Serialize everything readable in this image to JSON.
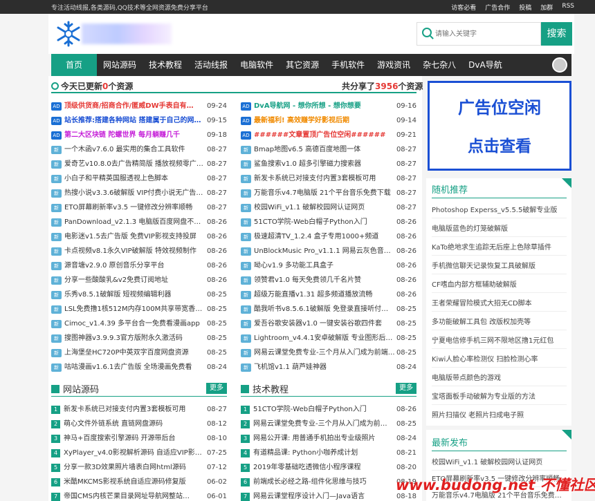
{
  "topbar": {
    "slogan": "专注活动线报,各类源码,QQ技术等全网资源免费分享平台",
    "links": [
      "访客必看",
      "广告合作",
      "投稿",
      "加群",
      "RSS"
    ]
  },
  "search": {
    "placeholder": "请输入关键字",
    "button": "搜索"
  },
  "nav": [
    "首页",
    "网站源码",
    "技术教程",
    "活动线报",
    "电脑软件",
    "其它资源",
    "手机软件",
    "游戏资讯",
    "杂七杂八",
    "DvA导航"
  ],
  "stats": {
    "today_prefix": "今天已更新",
    "today_count": "0",
    "today_suffix": "个资源",
    "total_prefix": "共分享了",
    "total_count": "3956",
    "total_suffix": "个资源"
  },
  "colors": {
    "accent": "#16a085",
    "dark": "#2d2d2d",
    "ad_blue": "#1a4fd4",
    "new_tag": "#5eb1d7",
    "red": "#e53935"
  },
  "left_list": [
    {
      "tag": "AD",
      "text": "顶级供货商/招商合作/匿威DW手表自有…",
      "date": "09-24",
      "style": "red"
    },
    {
      "tag": "AD",
      "text": "站长推荐:搭建各种网站 搭建属于自己的网…",
      "date": "09-15",
      "style": "blue"
    },
    {
      "tag": "AD",
      "text": "第二大区块链 陀螺世界 每月躺赚几千",
      "date": "09-18",
      "style": "purple"
    },
    {
      "tag": "新",
      "text": "一个木函v7.6.0 最实用的集合工具软件",
      "date": "08-27"
    },
    {
      "tag": "新",
      "text": "爱奇艺v10.8.0去广告精简版 播放视频零广…",
      "date": "08-27"
    },
    {
      "tag": "新",
      "text": "小白子和平精英国服透视上色脚本",
      "date": "08-27"
    },
    {
      "tag": "新",
      "text": "热搜小说v3.3.6破解版 VIP付费小说无广告…",
      "date": "08-27"
    },
    {
      "tag": "新",
      "text": "ETO屏幕刷新率v3.5 一键修改分辨率顺畅",
      "date": "08-27"
    },
    {
      "tag": "新",
      "text": "PanDownload_v2.1.3 电脑版百度网盘不…",
      "date": "08-26"
    },
    {
      "tag": "新",
      "text": "电影迷v1.5去广告版 免费VIP影视支持投屏",
      "date": "08-26"
    },
    {
      "tag": "新",
      "text": "卡点视频v8.1永久VIP破解版 特效视频制作",
      "date": "08-26"
    },
    {
      "tag": "新",
      "text": "源音塘v2.9.0 原创音乐分享平台",
      "date": "08-26"
    },
    {
      "tag": "新",
      "text": "分享一些酸酸乳&v2免费订阅地址",
      "date": "08-26"
    },
    {
      "tag": "新",
      "text": "乐秀v8.5.1破解版 短视频编辑利器",
      "date": "08-25"
    },
    {
      "tag": "新",
      "text": "LSL免费撸1核512M内存100M共享带宽香…",
      "date": "08-25"
    },
    {
      "tag": "新",
      "text": "Cimoc_v1.4.39 多平台合一免费看漫画app",
      "date": "08-25"
    },
    {
      "tag": "新",
      "text": "搜图神器v3.9.9.3官方版附永久激活码",
      "date": "08-25"
    },
    {
      "tag": "新",
      "text": "上海堡垒HC720P中英双字百度网盘资源",
      "date": "08-25"
    },
    {
      "tag": "新",
      "text": "咕咕漫画v1.6.1去广告版 全场漫画免费看",
      "date": "08-24"
    }
  ],
  "right_list": [
    {
      "tag": "AD",
      "text": "DvA导航网 - 想你所想 - 想你想要",
      "date": "09-16",
      "style": "green"
    },
    {
      "tag": "AD",
      "text": "最新福利! 高效赚学好影视后期",
      "date": "09-14",
      "style": "orange"
    },
    {
      "tag": "AD",
      "text": "######文章置顶广告位空闲######",
      "date": "09-21",
      "style": "red"
    },
    {
      "tag": "新",
      "text": "Bmap地图v6.5 高德百度地图一体",
      "date": "08-27"
    },
    {
      "tag": "新",
      "text": "鲨鱼搜索v1.0 超多引擎磁力搜索器",
      "date": "08-27"
    },
    {
      "tag": "新",
      "text": "新发卡系统已对接支付内置3套模板可用",
      "date": "08-27"
    },
    {
      "tag": "新",
      "text": "万能音乐v4.7电脑版 21个平台音乐免费下载",
      "date": "08-27"
    },
    {
      "tag": "新",
      "text": "校园WiFi_v1.1 破解校园网认证网页",
      "date": "08-27"
    },
    {
      "tag": "新",
      "text": "51CTO学院-Web白帽子Python入门",
      "date": "08-26"
    },
    {
      "tag": "新",
      "text": "极速超清TV_1.2.4 盒子专用1000+频道",
      "date": "08-26"
    },
    {
      "tag": "新",
      "text": "UnBlockMusic Pro_v1.1.1 网易云灰色音…",
      "date": "08-26"
    },
    {
      "tag": "新",
      "text": "呦心v1.9 多功能工具盒子",
      "date": "08-26"
    },
    {
      "tag": "新",
      "text": "领赞君v1.0 每天免费领几千名片赞",
      "date": "08-26"
    },
    {
      "tag": "新",
      "text": "超级万能直播v1.31 超多频道播放流畅",
      "date": "08-26"
    },
    {
      "tag": "新",
      "text": "酷我听书v8.5.6.1破解版 免登录直接听付…",
      "date": "08-25"
    },
    {
      "tag": "新",
      "text": "爱吾谷歌安装器v1.0 一键安装谷歌四件套",
      "date": "08-25"
    },
    {
      "tag": "新",
      "text": "Lightroom_v4.4.1安卓破解版 专业图形后…",
      "date": "08-25"
    },
    {
      "tag": "新",
      "text": "网易云课堂免费专业-三个月从入门成为前端…",
      "date": "08-25"
    },
    {
      "tag": "新",
      "text": "飞机馆v1.1 葫芦娃神器",
      "date": "08-24"
    }
  ],
  "section_site": {
    "title": "网站源码",
    "more": "更多",
    "items": [
      {
        "n": "1",
        "text": "新发卡系统已对接支付内置3套模板可用",
        "date": "08-27"
      },
      {
        "n": "2",
        "text": "萌心文件外链系统 直链网盘源码",
        "date": "08-12"
      },
      {
        "n": "3",
        "text": "神马+百度搜索引擎源码 开源带后台",
        "date": "08-10"
      },
      {
        "n": "4",
        "text": "XyPlayer_v4.0影视解析源码 自适应VIP影…",
        "date": "07-25"
      },
      {
        "n": "5",
        "text": "分享一款3D效果照片墙表白网html源码",
        "date": "07-12"
      },
      {
        "n": "6",
        "text": "米酷MKCMS影视系统自适应源码修复版",
        "date": "06-02"
      },
      {
        "n": "7",
        "text": "帝国CMS内核芒果目录网址导航网整站…",
        "date": "06-01"
      }
    ]
  },
  "section_tech": {
    "title": "技术教程",
    "more": "更多",
    "items": [
      {
        "n": "1",
        "text": "51CTO学院-Web白帽子Python入门",
        "date": "08-26"
      },
      {
        "n": "2",
        "text": "网易云课堂免费专业-三个月从入门成为前端…",
        "date": "08-25"
      },
      {
        "n": "3",
        "text": "网易公开课: 用普通手机拍出专业级照片",
        "date": "08-24"
      },
      {
        "n": "4",
        "text": "有道精品课: Python小咖养成计划",
        "date": "08-21"
      },
      {
        "n": "5",
        "text": "2019年零基础吃透微信小程序课程",
        "date": "08-20"
      },
      {
        "n": "6",
        "text": "前端成长必经之路-组件化思维与技巧",
        "date": "08-19"
      },
      {
        "n": "7",
        "text": "网易云课堂程序设计入门—Java语言",
        "date": "08-18"
      }
    ]
  },
  "ad_banner": {
    "line1": "广告位空闲",
    "line2": "点击查看"
  },
  "random": {
    "title": "随机推荐",
    "items": [
      "Photoshop Experss_v5.5.5破解专业版",
      "电脑版蓝色的灯笼破解版",
      "KaTo绝地求生追踪无后座上色除草插件",
      "手机微信聊天记录恢复工具破解版",
      "CF嗜血内部方框辅助破解版",
      "王者荣耀冒险模式大招无CD脚本",
      "多功能破解工具包 改版权加壳等",
      "宁夏电信修手机三网不限地区撸1元红包",
      "Kiwi人脸心率检测仪 扫脸检测心率",
      "电脑版带点颜色的游戏",
      "宝塔面板手动破解为专业版的方法",
      "照片扫描仪 老照片扫成电子照"
    ]
  },
  "latest": {
    "title": "最新发布",
    "items": [
      "校园WiFi_v1.1 破解校园网认证网页",
      "ETO屏幕刷新率v3.5 一键修改分辨率顺畅",
      "万能音乐v4.7电脑版 21个平台音乐免费…"
    ]
  },
  "watermark": "www.budong.net 不懂社区"
}
